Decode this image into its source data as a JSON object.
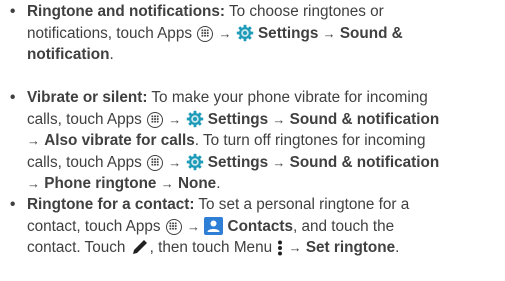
{
  "items": [
    {
      "bullet": "•",
      "lines": [
        {
          "t1": "Ringtone and notifications:",
          "t2": " To choose ringtones or"
        },
        {
          "t1": "notifications, touch Apps",
          "arrow1": "→",
          "settings": "Settings",
          "arrow2": "→",
          "t2": "Sound &"
        },
        {
          "t1": "notification",
          "t2": "."
        }
      ]
    },
    {
      "bullet": "•",
      "lines": [
        {
          "t1": "Vibrate or silent:",
          "t2": " To make your phone vibrate for incoming"
        },
        {
          "t1": "calls, touch Apps",
          "arrow1": "→",
          "settings": "Settings",
          "arrow2": "→",
          "t2": "Sound & notification"
        },
        {
          "arrow1": "→",
          "t1": "Also vibrate for calls",
          "t2": ". To turn off ringtones for incoming"
        },
        {
          "t1": "calls, touch Apps",
          "arrow1": "→",
          "settings": "Settings",
          "arrow2": "→",
          "t2": "Sound & notification"
        },
        {
          "arrow1": "→",
          "t1": "Phone ringtone",
          "arrow2": "→",
          "t2": "None",
          "t3": "."
        }
      ]
    },
    {
      "bullet": "•",
      "lines": [
        {
          "t1": "Ringtone for a contact:",
          "t2": " To set a personal ringtone for a"
        },
        {
          "t1": "contact, touch Apps",
          "arrow1": "→",
          "contacts": "Contacts",
          "t2": ", and touch the"
        },
        {
          "t1": "contact. Touch",
          "t2": ", then touch Menu",
          "arrow1": "→",
          "t3": "Set ringtone",
          "t4": "."
        }
      ]
    }
  ],
  "icons": {
    "apps": "apps-icon",
    "settings": "settings-gear-icon",
    "contacts": "contacts-icon",
    "edit": "edit-pencil-icon",
    "menu": "menu-more-icon"
  },
  "colors": {
    "text": "#404040",
    "settings_gear": "#1e9bb8",
    "contacts": "#2f7fd6"
  }
}
